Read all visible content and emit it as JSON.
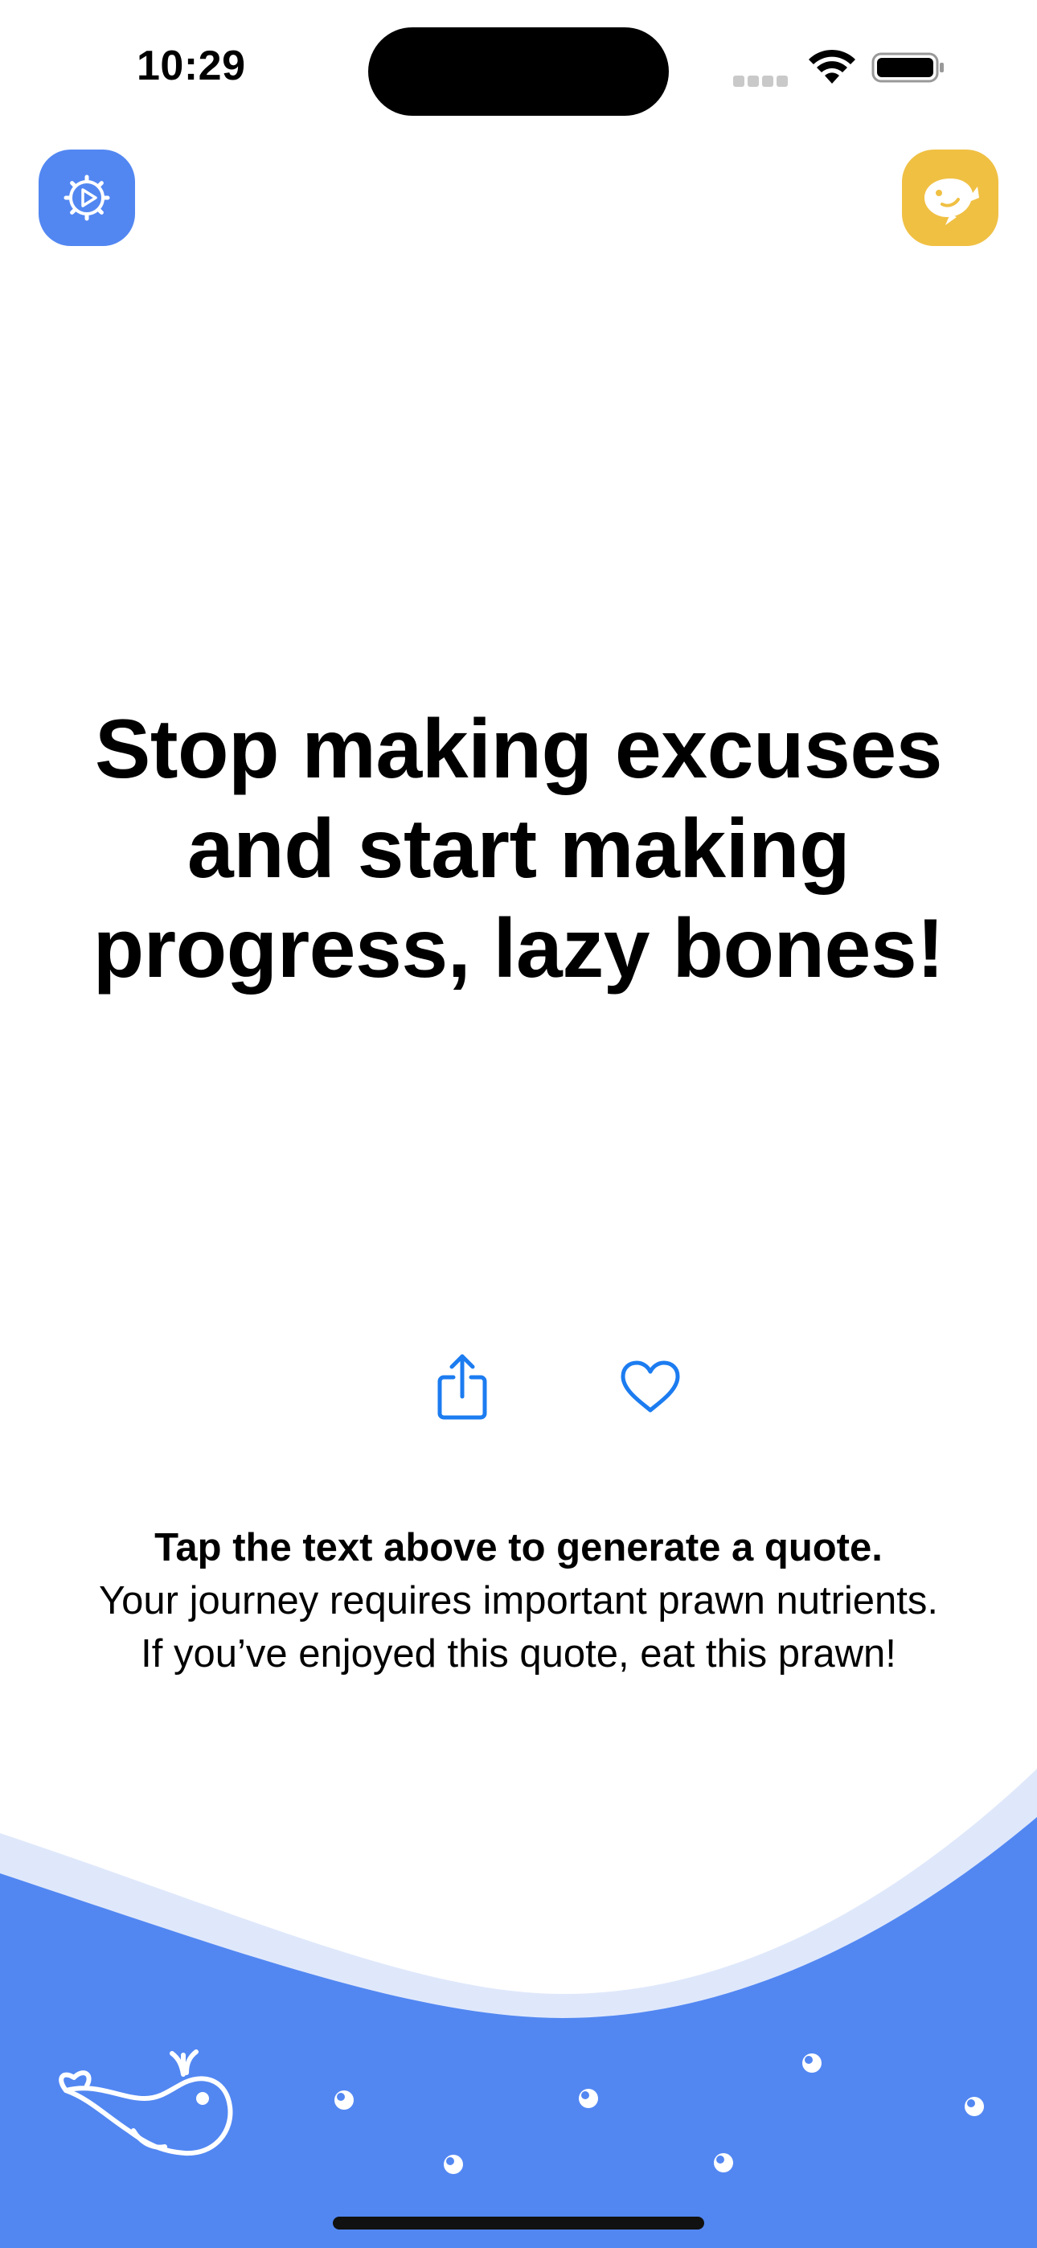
{
  "status_bar": {
    "time": "10:29",
    "icons": [
      "cellular-signal-icon",
      "wifi-icon",
      "battery-icon"
    ]
  },
  "toolbar": {
    "settings_icon": "gear-play-icon",
    "whale_icon": "whale-icon"
  },
  "quote": {
    "text": "Stop making excuses and start making progress, lazy bones!"
  },
  "actions": {
    "share_icon": "share-icon",
    "favorite_icon": "heart-icon"
  },
  "footer": {
    "instruction": "Tap the text above to generate a quote.",
    "message": "Your journey requires important prawn nutrients. If you’ve enjoyed this quote, eat this prawn!"
  },
  "colors": {
    "accent_blue": "#5287f2",
    "light_wave": "#dfe8fb",
    "whale_button": "#f0c043",
    "action_blue": "#1c7cf0"
  },
  "decor": {
    "mascot_icon": "whale-outline-icon",
    "prawn_icon": "prawn-icon"
  }
}
